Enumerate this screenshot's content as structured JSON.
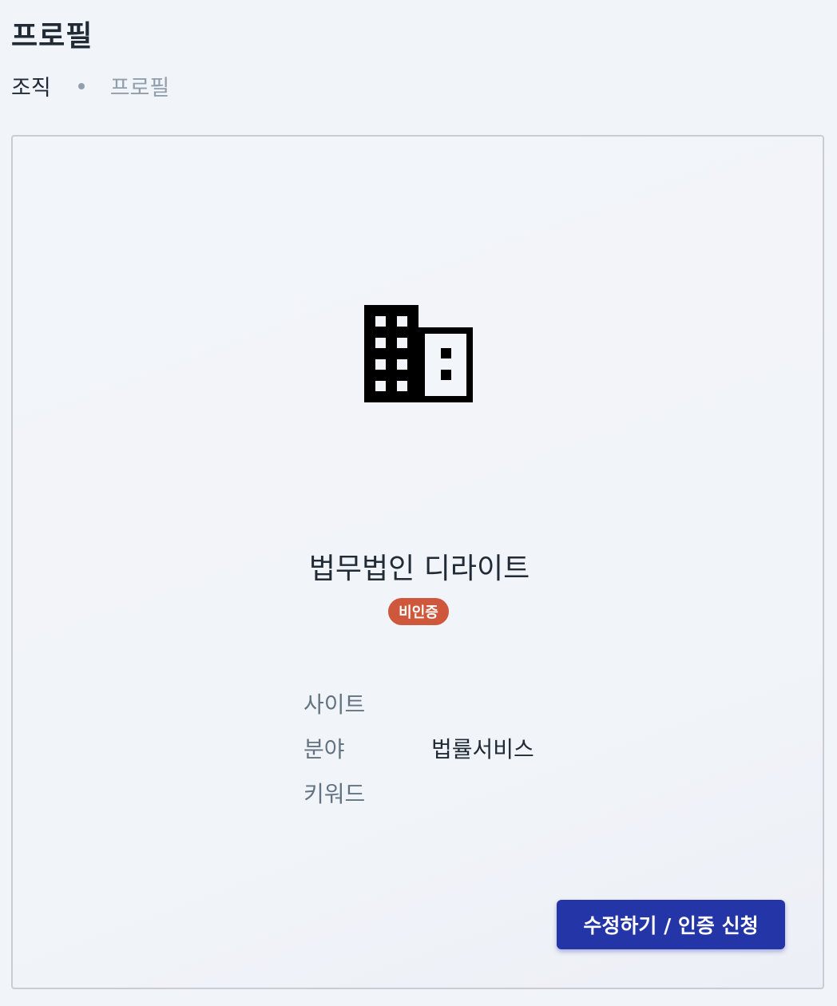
{
  "header": {
    "title": "프로필"
  },
  "breadcrumb": {
    "parent": "조직",
    "current": "프로필"
  },
  "profile": {
    "icon": "building-icon",
    "name": "법무법인 디라이트",
    "status_badge": "비인증",
    "status_color": "#cf573c",
    "fields": {
      "site_label": "사이트",
      "site_value": "",
      "field_label": "분야",
      "field_value": "법률서비스",
      "keyword_label": "키워드",
      "keyword_value": ""
    },
    "edit_button_label": "수정하기 / 인증 신청",
    "accent_color": "#2435a8"
  }
}
